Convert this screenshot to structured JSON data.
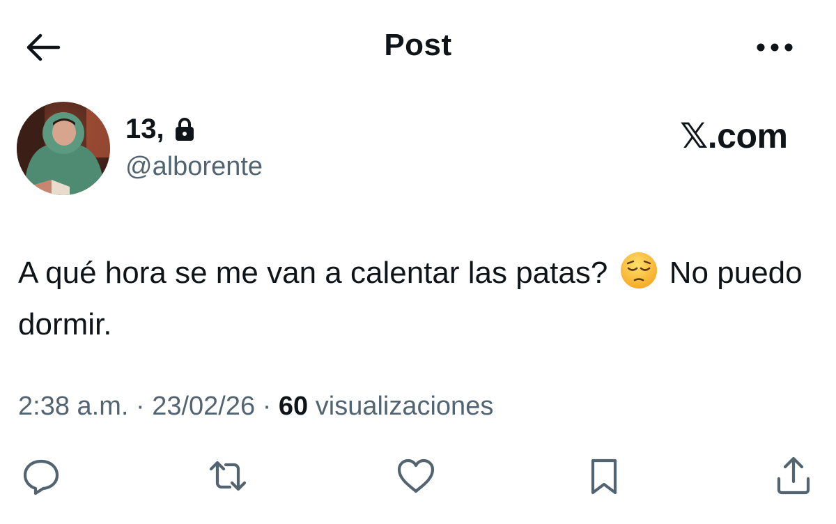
{
  "header": {
    "title": "Post",
    "back_icon": "arrow-left-icon",
    "more_icon": "more-horizontal-icon"
  },
  "author": {
    "display_name": "13,",
    "handle": "@alborente",
    "protected_icon": "lock-icon",
    "avatar_icon": "avatar-photo"
  },
  "brand": {
    "text": "𝕏.com"
  },
  "post": {
    "text_part1": "A qué hora se me van a calentar las patas?",
    "emoji_icon": "pensive-face-emoji",
    "text_part2": "No puedo dormir."
  },
  "meta": {
    "time": "2:38 a.m.",
    "separator": "·",
    "date": "23/02/26",
    "views_count": "60",
    "views_label": "visualizaciones"
  },
  "actions": [
    {
      "icon": "reply-icon"
    },
    {
      "icon": "repost-icon"
    },
    {
      "icon": "like-icon"
    },
    {
      "icon": "bookmark-icon"
    },
    {
      "icon": "share-icon"
    }
  ],
  "colors": {
    "text_primary": "#0f1419",
    "text_secondary": "#536471",
    "icon": "#536471",
    "background": "#ffffff"
  }
}
